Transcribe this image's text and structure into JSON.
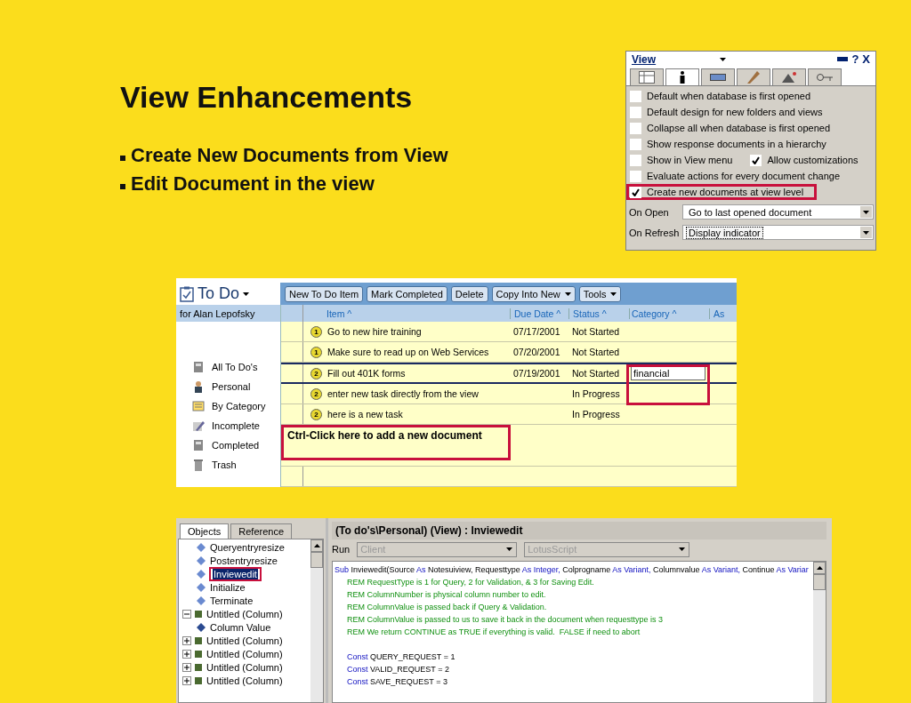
{
  "slide": {
    "title": "View Enhancements",
    "bullets": [
      "Create New Documents from View",
      "Edit Document in the view"
    ]
  },
  "view_properties": {
    "title": "View",
    "title_buttons": [
      "?",
      "X"
    ],
    "tabs": [
      {
        "selected": false
      },
      {
        "selected": true
      },
      {
        "selected": false
      },
      {
        "selected": false
      },
      {
        "selected": false
      },
      {
        "selected": false
      }
    ],
    "options": [
      {
        "highlighted": false,
        "items": [
          {
            "label": "Default when database is first opened",
            "checked": false
          }
        ]
      },
      {
        "highlighted": false,
        "items": [
          {
            "label": "Default design for new folders and views",
            "checked": false
          }
        ]
      },
      {
        "highlighted": false,
        "items": [
          {
            "label": "Collapse all when database is first opened",
            "checked": false
          }
        ]
      },
      {
        "highlighted": false,
        "items": [
          {
            "label": "Show response documents in a hierarchy",
            "checked": false
          }
        ]
      },
      {
        "highlighted": false,
        "items": [
          {
            "label": "Show in View menu",
            "checked": false
          },
          {
            "label": "Allow customizations",
            "checked": true
          }
        ]
      },
      {
        "highlighted": false,
        "items": [
          {
            "label": "Evaluate actions for every document change",
            "checked": false
          }
        ]
      },
      {
        "highlighted": true,
        "items": [
          {
            "label": "Create new documents at view level",
            "checked": true
          }
        ]
      }
    ],
    "fields": [
      {
        "label": "On Open",
        "value": "Go to last opened document",
        "focused": false
      },
      {
        "label": "On Refresh",
        "value": "Display indicator",
        "focused": true
      }
    ]
  },
  "todo": {
    "title": "To Do",
    "owner": "for Alan Lepofsky",
    "sidebar": [
      {
        "label": "All To Do's"
      },
      {
        "label": "Personal"
      },
      {
        "label": "By Category"
      },
      {
        "label": "Incomplete"
      },
      {
        "label": "Completed"
      },
      {
        "label": "Trash"
      }
    ],
    "buttons": [
      {
        "label": "New To Do Item",
        "dropdown": false
      },
      {
        "label": "Mark Completed",
        "dropdown": false
      },
      {
        "label": "Delete",
        "dropdown": false
      },
      {
        "label": "Copy Into New",
        "dropdown": true
      },
      {
        "label": "Tools",
        "dropdown": true
      }
    ],
    "columns": [
      "Item ^",
      "Due Date ^",
      "Status ^",
      "Category ^",
      "As"
    ],
    "rows": [
      {
        "priority": "1",
        "item": "Go to new hire training",
        "due": "07/17/2001",
        "status": "Not Started",
        "selected": false,
        "highlighted": false
      },
      {
        "priority": "1",
        "item": "Make sure to read up on Web Services",
        "due": "07/20/2001",
        "status": "Not Started",
        "selected": false,
        "highlighted": false
      },
      {
        "priority": "2",
        "item": "Fill out 401K forms",
        "due": "07/19/2001",
        "status": "Not Started",
        "category": "financial",
        "selected": true,
        "highlighted": true
      },
      {
        "priority": "2",
        "item": "enter new task directly from the view",
        "status": "In Progress",
        "selected": false,
        "highlighted": false
      },
      {
        "priority": "2",
        "item": "here is a new task",
        "status": "In Progress",
        "selected": false,
        "highlighted": false
      }
    ],
    "new_document_hint": {
      "text": "Ctrl-Click here to add a new document",
      "highlighted": true
    }
  },
  "designer": {
    "tabs": [
      {
        "label": "Objects",
        "selected": true
      },
      {
        "label": "Reference",
        "selected": false
      }
    ],
    "tree": [
      {
        "label": "Queryentryresize",
        "kind": "event",
        "selected": false,
        "highlighted": false
      },
      {
        "label": "Postentryresize",
        "kind": "event",
        "selected": false,
        "highlighted": false
      },
      {
        "label": "Inviewedit",
        "kind": "event",
        "selected": true,
        "highlighted": true
      },
      {
        "label": "Initialize",
        "kind": "event",
        "selected": false,
        "highlighted": false
      },
      {
        "label": "Terminate",
        "kind": "event",
        "selected": false,
        "highlighted": false
      },
      {
        "label": "Untitled (Column)",
        "kind": "column",
        "expanded": true,
        "selected": false,
        "highlighted": false,
        "children": [
          {
            "label": "Column Value",
            "kind": "value",
            "selected": false,
            "highlighted": false
          }
        ]
      },
      {
        "label": "Untitled (Column)",
        "kind": "column",
        "expanded": false,
        "selected": false,
        "highlighted": false
      },
      {
        "label": "Untitled (Column)",
        "kind": "column",
        "expanded": false,
        "selected": false,
        "highlighted": false
      },
      {
        "label": "Untitled (Column)",
        "kind": "column",
        "expanded": false,
        "selected": false,
        "highlighted": false
      },
      {
        "label": "Untitled (Column)",
        "kind": "column",
        "expanded": false,
        "selected": false,
        "highlighted": false
      }
    ],
    "title": "(To do's\\Personal) (View) : Inviewedit",
    "run_label": "Run",
    "run_fields": [
      "Client",
      "LotusScript"
    ],
    "code": [
      {
        "tokens": [
          {
            "kind": "keyword",
            "text": "Sub"
          },
          {
            "kind": "plain",
            "text": " Inviewedit(Source "
          },
          {
            "kind": "keyword",
            "text": "As"
          },
          {
            "kind": "plain",
            "text": " Notesuiview, Requesttype "
          },
          {
            "kind": "keyword",
            "text": "As Integer,"
          },
          {
            "kind": "plain",
            "text": " Colprogname "
          },
          {
            "kind": "keyword",
            "text": "As Variant,"
          },
          {
            "kind": "plain",
            "text": " Columnvalue "
          },
          {
            "kind": "keyword",
            "text": "As Variant,"
          },
          {
            "kind": "plain",
            "text": " Continue "
          },
          {
            "kind": "keyword",
            "text": "As Variar"
          }
        ],
        "children": [
          [
            {
              "tokens": [
                {
                  "kind": "comment",
                  "text": "REM RequestType is 1 for Query, 2 for Validation, & 3 for Saving Edit."
                }
              ]
            },
            {
              "tokens": [
                {
                  "kind": "comment",
                  "text": "REM ColumnNumber is physical column number to edit."
                }
              ]
            },
            {
              "tokens": [
                {
                  "kind": "comment",
                  "text": "REM ColumnValue is passed back if Query & Validation."
                }
              ]
            },
            {
              "tokens": [
                {
                  "kind": "comment",
                  "text": "REM ColumnValue is passed to us to save it back in the document when requesttype is 3"
                }
              ]
            },
            {
              "tokens": [
                {
                  "kind": "comment",
                  "text": "REM We return CONTINUE as TRUE if everything is valid.  FALSE if need to abort"
                }
              ]
            }
          ],
          [
            {
              "tokens": [
                {
                  "kind": "keyword",
                  "text": "Const"
                },
                {
                  "kind": "plain",
                  "text": " QUERY_REQUEST = 1"
                }
              ]
            },
            {
              "tokens": [
                {
                  "kind": "keyword",
                  "text": "Const"
                },
                {
                  "kind": "plain",
                  "text": " VALID_REQUEST = 2"
                }
              ]
            },
            {
              "tokens": [
                {
                  "kind": "keyword",
                  "text": "Const"
                },
                {
                  "kind": "plain",
                  "text": " SAVE_REQUEST = 3"
                }
              ]
            }
          ]
        ]
      }
    ]
  }
}
